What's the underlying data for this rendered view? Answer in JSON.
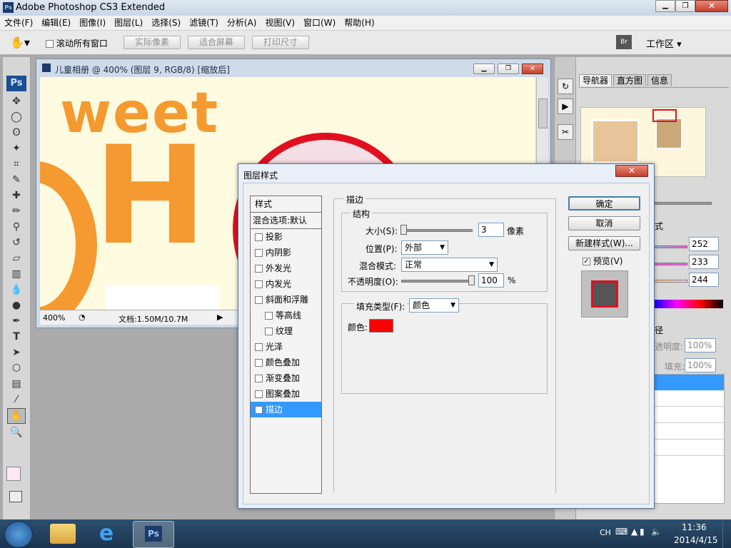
{
  "app": {
    "title": "Adobe Photoshop CS3 Extended",
    "ps_badge": "Ps"
  },
  "menu": [
    "文件(F)",
    "编辑(E)",
    "图像(I)",
    "图层(L)",
    "选择(S)",
    "滤镜(T)",
    "分析(A)",
    "视图(V)",
    "窗口(W)",
    "帮助(H)"
  ],
  "options": {
    "scroll_all": "滚动所有窗口",
    "actual_pixels": "实际像素",
    "fit_screen": "适合屏幕",
    "print_size": "打印尺寸",
    "workspace": "工作区"
  },
  "document": {
    "title": "儿童相册 @ 400% (图层 9, RGB/8) [缩放后]",
    "zoom": "400%",
    "doc_info": "文档:1.50M/10.7M",
    "canvas_text_1": "weet",
    "canvas_text_2": "H"
  },
  "panels": {
    "tabs": [
      "导航器",
      "直方图",
      "信息"
    ],
    "color_values": [
      "252",
      "233",
      "244"
    ],
    "opacity_label": "透明度:",
    "opacity_value": "100%",
    "fill_label": "填充:",
    "fill_value": "100%",
    "layers_tab_fragment": "径",
    "styles_tab_fragment": "式"
  },
  "dialog": {
    "title": "图层样式",
    "styles_header": "样式",
    "blend_default": "混合选项:默认",
    "style_items": [
      {
        "label": "投影",
        "checked": false
      },
      {
        "label": "内阴影",
        "checked": false
      },
      {
        "label": "外发光",
        "checked": false
      },
      {
        "label": "内发光",
        "checked": false
      },
      {
        "label": "斜面和浮雕",
        "checked": false
      },
      {
        "label": "等高线",
        "checked": false
      },
      {
        "label": "纹理",
        "checked": false
      },
      {
        "label": "光泽",
        "checked": false
      },
      {
        "label": "颜色叠加",
        "checked": false
      },
      {
        "label": "渐变叠加",
        "checked": false
      },
      {
        "label": "图案叠加",
        "checked": false
      },
      {
        "label": "描边",
        "checked": true
      }
    ],
    "stroke": {
      "section_title": "描边",
      "structure_title": "结构",
      "size_label": "大小(S):",
      "size_value": "3",
      "size_unit": "像素",
      "position_label": "位置(P):",
      "position_value": "外部",
      "blend_label": "混合模式:",
      "blend_value": "正常",
      "opacity_label": "不透明度(O):",
      "opacity_value": "100",
      "opacity_unit": "%",
      "fill_type_label": "填充类型(F):",
      "fill_type_value": "颜色",
      "color_label": "颜色:",
      "color_hex": "#ff0000"
    },
    "buttons": {
      "ok": "确定",
      "cancel": "取消",
      "new_style": "新建样式(W)...",
      "preview": "预览(V)"
    }
  },
  "taskbar": {
    "lang": "CH",
    "time": "11:36",
    "date": "2014/4/15",
    "ps_label": "Ps"
  }
}
